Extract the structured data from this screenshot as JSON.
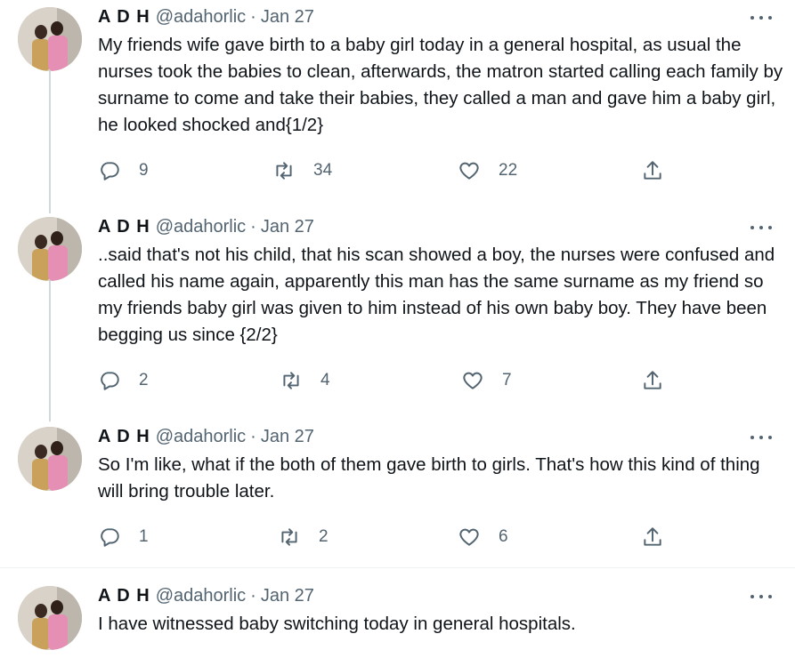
{
  "tweets": [
    {
      "name": "A D H",
      "handle": "@adahorlic",
      "sep": "·",
      "date": "Jan 27",
      "text": "My friends wife gave birth to a baby girl today in a general hospital, as usual the nurses took the babies to clean, afterwards, the matron started calling each family by surname to come and take their babies, they called a man and gave him a baby girl, he looked shocked and{1/2}",
      "replies": "9",
      "retweets": "34",
      "likes": "22"
    },
    {
      "name": "A D H",
      "handle": "@adahorlic",
      "sep": "·",
      "date": "Jan 27",
      "text": "..said that's not his child, that his scan showed a boy, the nurses were confused and called his name again, apparently this man has the same surname as my friend so my friends baby girl was given to him instead of his own baby boy. They have been begging us since {2/2}",
      "replies": "2",
      "retweets": "4",
      "likes": "7"
    },
    {
      "name": "A D H",
      "handle": "@adahorlic",
      "sep": "·",
      "date": "Jan 27",
      "text": "So I'm like, what if the both of them gave birth to girls. That's how this kind of thing will bring trouble later.",
      "replies": "1",
      "retweets": "2",
      "likes": "6"
    },
    {
      "name": "A D H",
      "handle": "@adahorlic",
      "sep": "·",
      "date": "Jan 27",
      "text": "I have witnessed baby switching today in general hospitals."
    }
  ],
  "icons": {
    "reply": "reply-icon",
    "retweet": "retweet-icon",
    "like": "heart-icon",
    "share": "share-icon",
    "more": "more-icon"
  },
  "colors": {
    "text": "#0f1419",
    "secondary": "#536471",
    "thread_line": "#cfd9de"
  }
}
